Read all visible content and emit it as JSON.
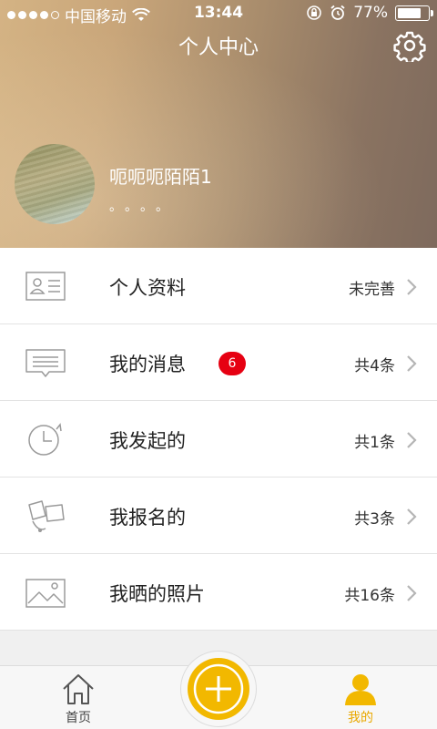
{
  "status_bar": {
    "carrier": "中国移动",
    "time": "13:44",
    "battery": "77%",
    "battery_level": 0.77
  },
  "header": {
    "title": "个人中心",
    "settings_icon": "gear-icon"
  },
  "profile": {
    "username": "呃呃呃陌陌1",
    "signature": "。。。。"
  },
  "menu": {
    "items": [
      {
        "label": "个人资料",
        "value": "未完善",
        "icon": "id-card-icon"
      },
      {
        "label": "我的消息",
        "value": "共4条",
        "badge": "6",
        "icon": "message-icon"
      },
      {
        "label": "我发起的",
        "value": "共1条",
        "icon": "clock-icon"
      },
      {
        "label": "我报名的",
        "value": "共3条",
        "icon": "signup-icon"
      },
      {
        "label": "我晒的照片",
        "value": "共16条",
        "icon": "photo-icon"
      }
    ]
  },
  "tabbar": {
    "home_label": "首页",
    "me_label": "我的",
    "add_icon": "plus-icon",
    "active_color": "#e9a800",
    "fab_color": "#f2b800"
  },
  "colors": {
    "badge": "#e60012",
    "text": "#222222"
  }
}
